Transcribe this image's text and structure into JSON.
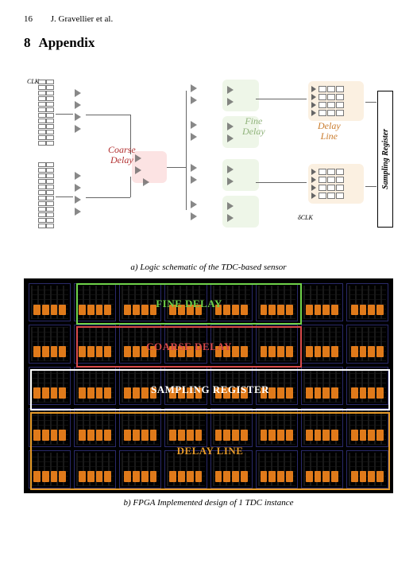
{
  "header": {
    "page_number": "16",
    "running_head": "J. Gravellier et al."
  },
  "section": {
    "number": "8",
    "title": "Appendix"
  },
  "schematic": {
    "clk_label": "CLK",
    "delta_clk_label": "δCLK",
    "coarse_label": "Coarse\nDelay",
    "fine_label": "Fine\nDelay",
    "delay_line_label": "Delay\nLine",
    "sampling_register_label": "Sampling Register",
    "caption": "a) Logic schematic of the TDC-based sensor"
  },
  "fpga": {
    "regions": {
      "fine": "FINE DELAY",
      "coarse": "COARSE DELAY",
      "sampling": "SAMPLING REGISTER",
      "delay_line": "DELAY LINE"
    },
    "caption": "b) FPGA Implemented design of 1 TDC instance"
  }
}
